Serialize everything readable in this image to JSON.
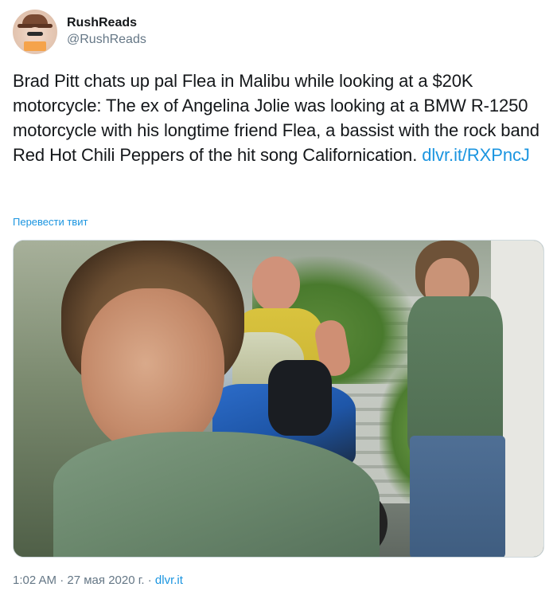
{
  "author": {
    "display_name": "RushReads",
    "handle": "@RushReads",
    "avatar_icon": "user-avatar"
  },
  "tweet": {
    "text": "Brad Pitt chats up pal Flea in Malibu while looking at a $20K motorcycle: The ex of Angelina Jolie was looking at a BMW R-1250 motorcycle with his longtime friend Flea, a bassist with the rock band Red Hot Chili Peppers of the hit song Californication. ",
    "link": "dlvr.it/RXPncJ",
    "translate_label": "Перевести твит"
  },
  "meta": {
    "time": "1:02 AM",
    "sep1": " · ",
    "date": "27 мая 2020 г.",
    "sep2": " · ",
    "source": "dlvr.it"
  },
  "colors": {
    "link": "#1b95e0",
    "text": "#14171a",
    "secondary": "#657786"
  }
}
